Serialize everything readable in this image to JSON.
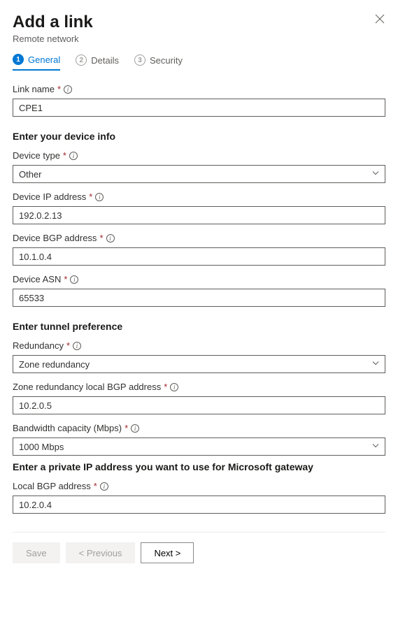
{
  "header": {
    "title": "Add a link",
    "subtitle": "Remote network"
  },
  "tabs": {
    "general": "General",
    "details": "Details",
    "security": "Security"
  },
  "fields": {
    "link_name": {
      "label": "Link name",
      "value": "CPE1"
    },
    "device_info_heading": "Enter your device info",
    "device_type": {
      "label": "Device type",
      "value": "Other"
    },
    "device_ip": {
      "label": "Device IP address",
      "value": "192.0.2.13"
    },
    "device_bgp": {
      "label": "Device BGP address",
      "value": "10.1.0.4"
    },
    "device_asn": {
      "label": "Device ASN",
      "value": "65533"
    },
    "tunnel_heading": "Enter tunnel preference",
    "redundancy": {
      "label": "Redundancy",
      "value": "Zone redundancy"
    },
    "zone_local_bgp": {
      "label": "Zone redundancy local BGP address",
      "value": "10.2.0.5"
    },
    "bandwidth": {
      "label": "Bandwidth capacity (Mbps)",
      "value": "1000 Mbps"
    },
    "private_ip_heading": "Enter a private IP address you want to use for Microsoft gateway",
    "local_bgp": {
      "label": "Local BGP address",
      "value": "10.2.0.4"
    }
  },
  "footer": {
    "save": "Save",
    "previous": "< Previous",
    "next": "Next >"
  }
}
